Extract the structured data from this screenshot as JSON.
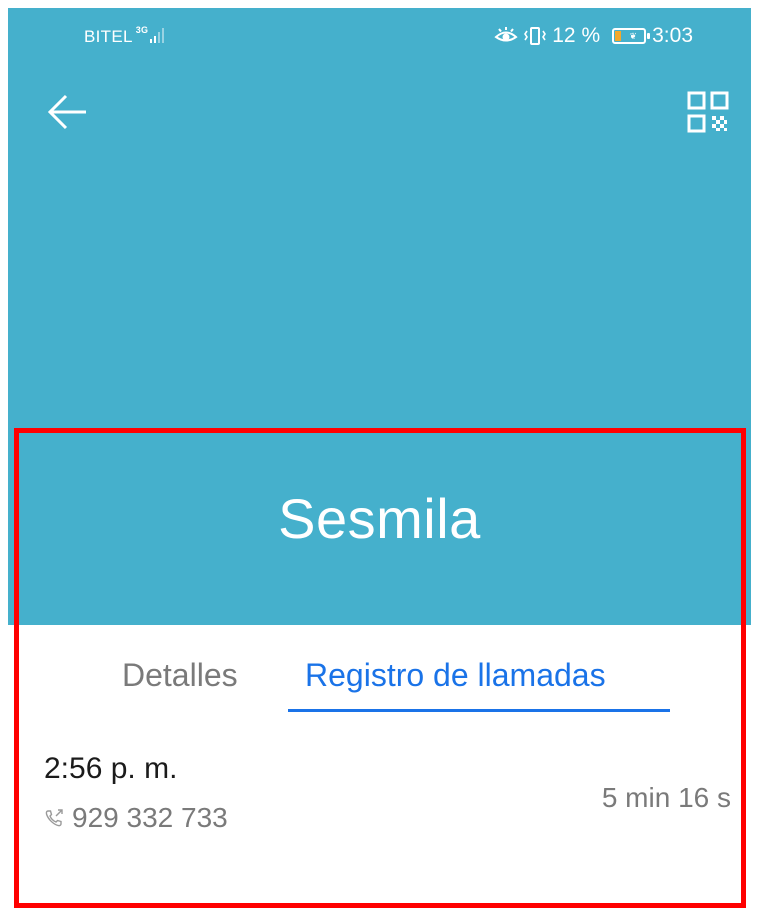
{
  "status_bar": {
    "carrier": "BITEL",
    "network": "3G",
    "battery_percent": "12 %",
    "time": "3:03"
  },
  "header": {
    "back_icon": "back-arrow-icon",
    "qr_icon": "qr-code-icon",
    "contact_name": "Sesmila"
  },
  "tabs": [
    {
      "label": "Detalles",
      "selected": false
    },
    {
      "label": "Registro de llamadas",
      "selected": true
    }
  ],
  "call_log": [
    {
      "time": "2:56 p. m.",
      "number": "929 332 733",
      "duration": "5 min 16 s",
      "icon": "outgoing-call-icon"
    }
  ],
  "colors": {
    "header_bg": "#45b0cc",
    "accent": "#1a73e8",
    "highlight": "#ff0000"
  }
}
